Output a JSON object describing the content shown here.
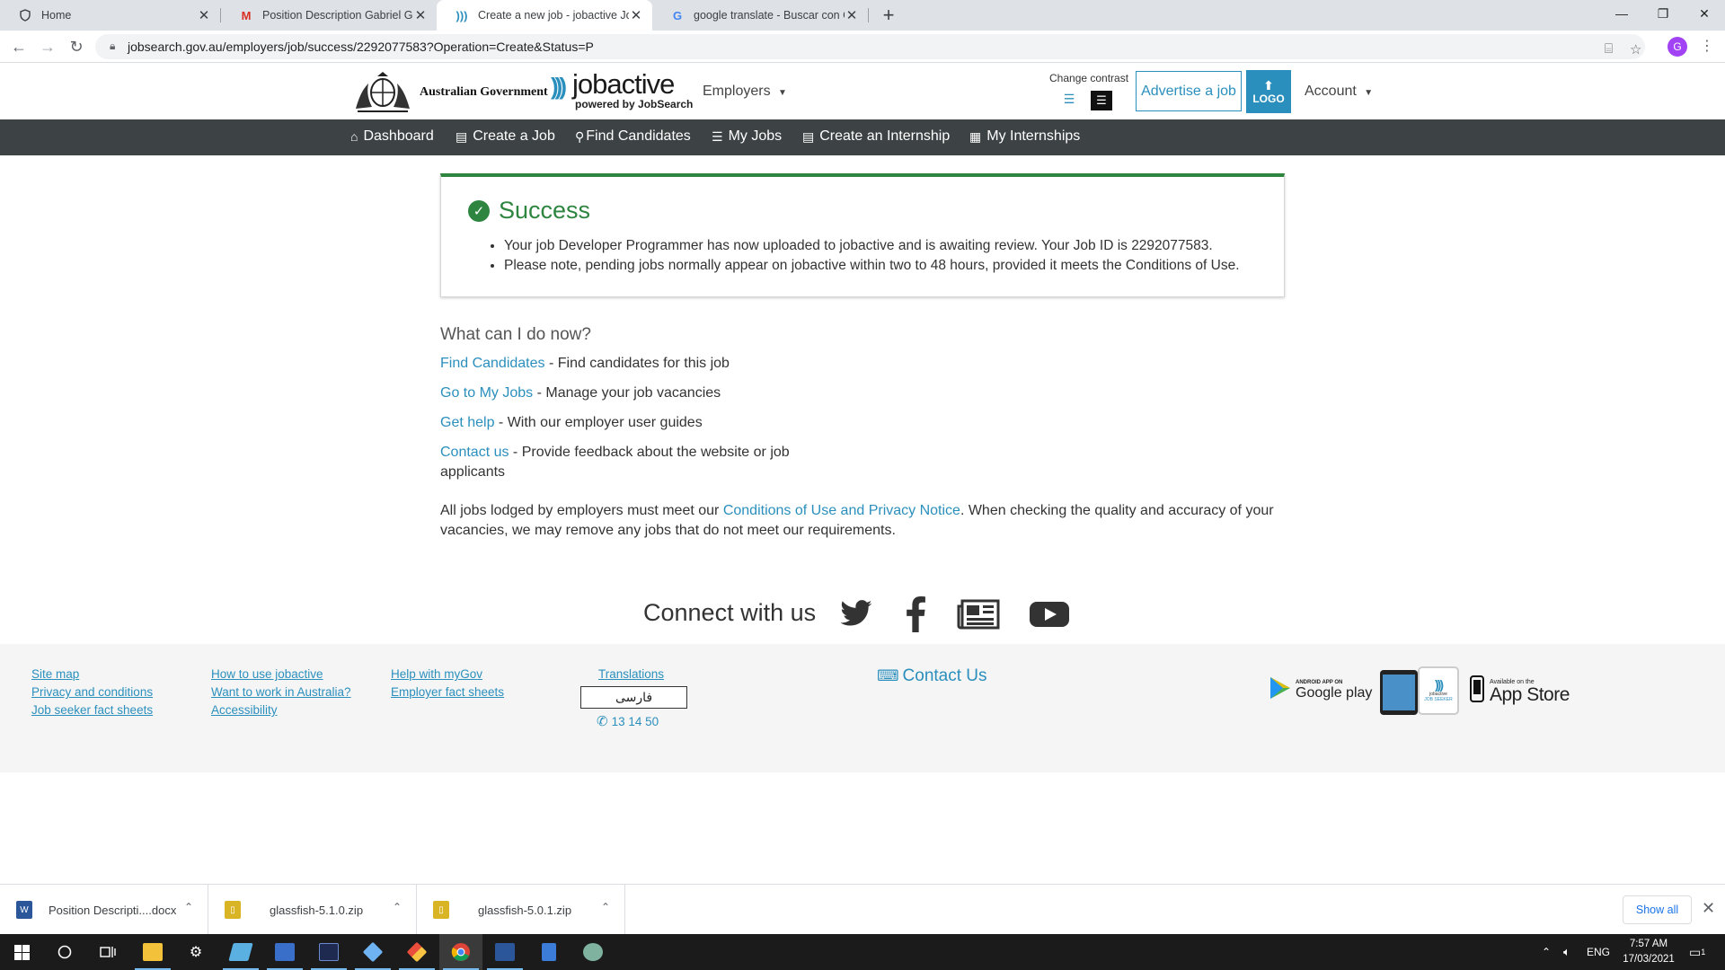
{
  "browser": {
    "tabs": [
      {
        "title": "Home",
        "icon": "shield-icon"
      },
      {
        "title": "Position Description Gabriel Grill",
        "icon": "gmail-icon"
      },
      {
        "title": "Create a new job - jobactive JobS",
        "icon": "jobactive-icon"
      },
      {
        "title": "google translate - Buscar con Go",
        "icon": "google-icon"
      }
    ],
    "url": "jobsearch.gov.au/employers/job/success/2292077583?Operation=Create&Status=P",
    "profile_initial": "G"
  },
  "header": {
    "gov_name": "Australian Government",
    "brand": "jobactive",
    "brand_sub": "powered by JobSearch",
    "employers_menu": "Employers",
    "change_contrast": "Change contrast",
    "advertise": "Advertise a job",
    "logo_button": "LOGO",
    "account_menu": "Account"
  },
  "nav": {
    "items": [
      {
        "label": "Dashboard",
        "icon": "home-icon"
      },
      {
        "label": "Create a Job",
        "icon": "id-card-icon"
      },
      {
        "label": "Find Candidates",
        "icon": "user-search-icon"
      },
      {
        "label": "My Jobs",
        "icon": "list-icon"
      },
      {
        "label": "Create an Internship",
        "icon": "id-card-icon"
      },
      {
        "label": "My Internships",
        "icon": "newspaper-icon"
      }
    ]
  },
  "success": {
    "title": "Success",
    "lines": [
      "Your job Developer Programmer has now uploaded to jobactive and is awaiting review. Your Job ID is 2292077583.",
      "Please note, pending jobs normally appear on jobactive within two to 48 hours, provided it meets the Conditions of Use."
    ]
  },
  "next_steps": {
    "title": "What can I do now?",
    "actions": [
      {
        "link": "Find Candidates",
        "text": " - Find candidates for this job"
      },
      {
        "link": "Go to My Jobs",
        "text": " - Manage your job vacancies"
      },
      {
        "link": "Get help",
        "text": " - With our employer user guides"
      },
      {
        "link": "Contact us",
        "text": " - Provide feedback about the website or job applicants"
      }
    ],
    "policy_before": "All jobs lodged by employers must meet our ",
    "policy_link": "Conditions of Use and Privacy Notice",
    "policy_after": ". When checking the quality and accuracy of your vacancies, we may remove any jobs that do not meet our requirements."
  },
  "connect": {
    "title": "Connect with us",
    "icons": [
      "twitter-icon",
      "facebook-icon",
      "news-icon",
      "youtube-icon"
    ]
  },
  "footer": {
    "col1": [
      "Site map",
      "Privacy and conditions",
      "Job seeker fact sheets"
    ],
    "col2": [
      "How to use jobactive",
      "Want to work in Australia?",
      "Accessibility"
    ],
    "col3": [
      "Help with myGov",
      "Employer fact sheets"
    ],
    "translations": "Translations",
    "language": "فارسی",
    "phone": "13 14 50",
    "contact": "Contact Us",
    "google_play_small": "ANDROID APP ON",
    "google_play": "Google play",
    "app_store_small": "Available on the",
    "app_store": "App Store",
    "phone_app_brand": "jobactive",
    "phone_app_sub": "JOB SEEKER"
  },
  "downloads": {
    "items": [
      {
        "name": "Position Descripti....docx",
        "color": "#2b579a"
      },
      {
        "name": "glassfish-5.1.0.zip",
        "color": "#d9b526"
      },
      {
        "name": "glassfish-5.0.1.zip",
        "color": "#d9b526"
      }
    ],
    "show_all": "Show all"
  },
  "taskbar": {
    "lang": "ENG",
    "time": "7:57 AM",
    "date": "17/03/2021",
    "notif_count": "1"
  },
  "colors": {
    "link": "#2b8fbd",
    "success": "#2e8540",
    "navbar": "#3d4245"
  }
}
